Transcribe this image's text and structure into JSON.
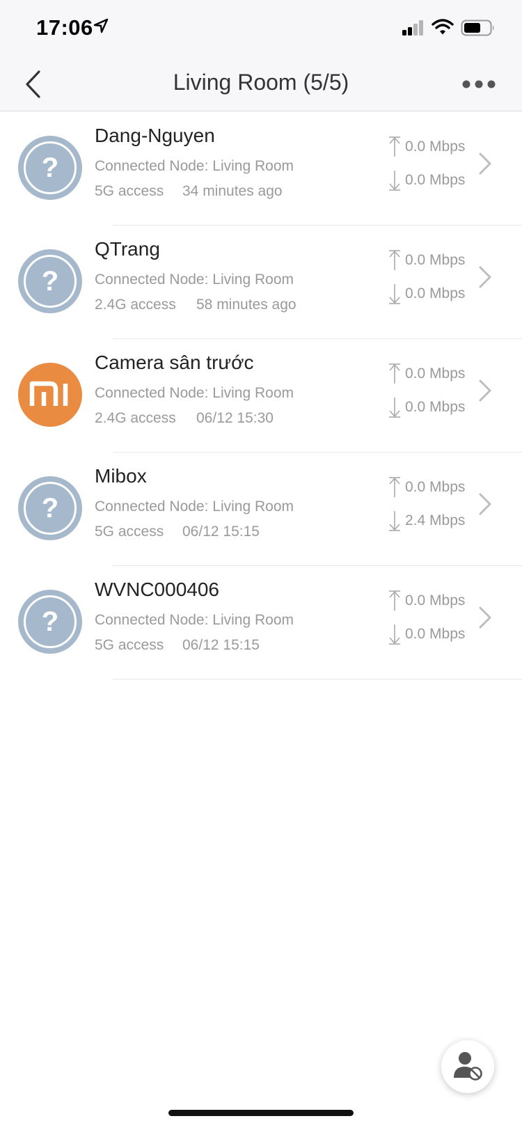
{
  "status_bar": {
    "time": "17:06",
    "icons": [
      "location-arrow-icon",
      "cellular-signal-icon",
      "wifi-icon",
      "battery-icon"
    ]
  },
  "nav": {
    "title": "Living Room (5/5)",
    "icons": [
      "back-chevron-icon",
      "more-dots-icon"
    ]
  },
  "colors": {
    "unknown_avatar": "#a6b8cc",
    "mi_avatar": "#ea8b42",
    "secondary_text": "#9a9a9a"
  },
  "devices": [
    {
      "name": "Dang-Nguyen",
      "node": "Connected Node: Living Room",
      "access": "5G access",
      "time": "34 minutes ago",
      "upload": "0.0 Mbps",
      "download": "0.0 Mbps",
      "icon": "unknown-device-icon"
    },
    {
      "name": "QTrang",
      "node": "Connected Node: Living Room",
      "access": "2.4G access",
      "time": "58 minutes ago",
      "upload": "0.0 Mbps",
      "download": "0.0 Mbps",
      "icon": "unknown-device-icon"
    },
    {
      "name": "Camera sân trước",
      "node": "Connected Node: Living Room",
      "access": "2.4G access",
      "time": "06/12 15:30",
      "upload": "0.0 Mbps",
      "download": "0.0 Mbps",
      "icon": "mi-logo-icon"
    },
    {
      "name": "Mibox",
      "node": "Connected Node: Living Room",
      "access": "5G access",
      "time": "06/12 15:15",
      "upload": "0.0 Mbps",
      "download": "2.4 Mbps",
      "icon": "unknown-device-icon"
    },
    {
      "name": "WVNC000406",
      "node": "Connected Node: Living Room",
      "access": "5G access",
      "time": "06/12 15:15",
      "upload": "0.0 Mbps",
      "download": "0.0 Mbps",
      "icon": "unknown-device-icon"
    }
  ],
  "fab": {
    "icon": "blocked-user-icon"
  }
}
